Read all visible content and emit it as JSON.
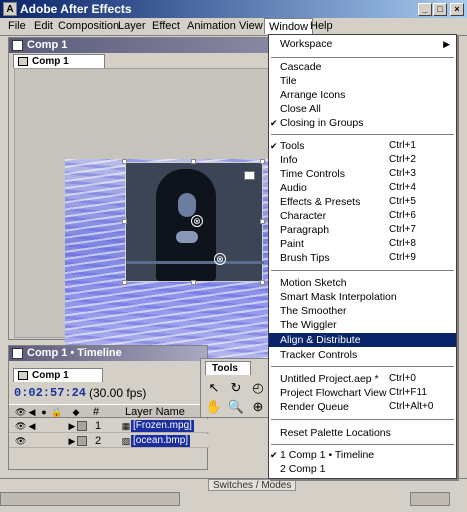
{
  "app": {
    "title": "Adobe After Effects",
    "icon_letter": "A"
  },
  "window_controls": {
    "minimize": "_",
    "maximize": "□",
    "close": "×"
  },
  "menubar": [
    "File",
    "Edit",
    "Composition",
    "Layer",
    "Effect",
    "Animation",
    "View",
    "Window",
    "Help"
  ],
  "comp_window": {
    "title": "Comp 1",
    "tab": "Comp 1"
  },
  "timeline": {
    "title": "Comp 1 • Timeline",
    "tab": "Comp 1",
    "timecode": "0:02:57:24",
    "fps": "(30.00 fps)",
    "col_hash": "#",
    "col_layer_name": "Layer Name",
    "layers": [
      {
        "num": "1",
        "name": "[Frozen.mpg]"
      },
      {
        "num": "2",
        "name": "[ocean.bmp]"
      }
    ]
  },
  "tools": {
    "tab": "Tools",
    "icons": [
      "arrow-icon",
      "rotate-icon",
      "camera-icon",
      "hand-icon",
      "zoom-icon",
      "pan-icon"
    ]
  },
  "bottom_bar": {
    "switches": "Switches / Modes"
  },
  "window_menu": {
    "items": [
      {
        "label": "Workspace",
        "submenu": true
      },
      {
        "sep": true
      },
      {
        "label": "Cascade"
      },
      {
        "label": "Tile"
      },
      {
        "label": "Arrange Icons"
      },
      {
        "label": "Close All"
      },
      {
        "label": "Closing in Groups",
        "checked": true
      },
      {
        "sep": true
      },
      {
        "label": "Tools",
        "shortcut": "Ctrl+1",
        "checked": true
      },
      {
        "label": "Info",
        "shortcut": "Ctrl+2"
      },
      {
        "label": "Time Controls",
        "shortcut": "Ctrl+3"
      },
      {
        "label": "Audio",
        "shortcut": "Ctrl+4"
      },
      {
        "label": "Effects & Presets",
        "shortcut": "Ctrl+5"
      },
      {
        "label": "Character",
        "shortcut": "Ctrl+6"
      },
      {
        "label": "Paragraph",
        "shortcut": "Ctrl+7"
      },
      {
        "label": "Paint",
        "shortcut": "Ctrl+8"
      },
      {
        "label": "Brush Tips",
        "shortcut": "Ctrl+9"
      },
      {
        "sep": true
      },
      {
        "label": "Motion Sketch"
      },
      {
        "label": "Smart Mask Interpolation"
      },
      {
        "label": "The Smoother"
      },
      {
        "label": "The Wiggler"
      },
      {
        "label": "Align & Distribute",
        "highlighted": true
      },
      {
        "label": "Tracker Controls"
      },
      {
        "sep": true
      },
      {
        "label": "Untitled Project.aep *",
        "shortcut": "Ctrl+0"
      },
      {
        "label": "Project Flowchart View",
        "shortcut": "Ctrl+F11"
      },
      {
        "label": "Render Queue",
        "shortcut": "Ctrl+Alt+0"
      },
      {
        "sep": true
      },
      {
        "label": "Reset Palette Locations"
      },
      {
        "sep": true
      },
      {
        "label": "1 Comp 1 • Timeline",
        "checked": true
      },
      {
        "label": "2 Comp 1"
      }
    ]
  }
}
